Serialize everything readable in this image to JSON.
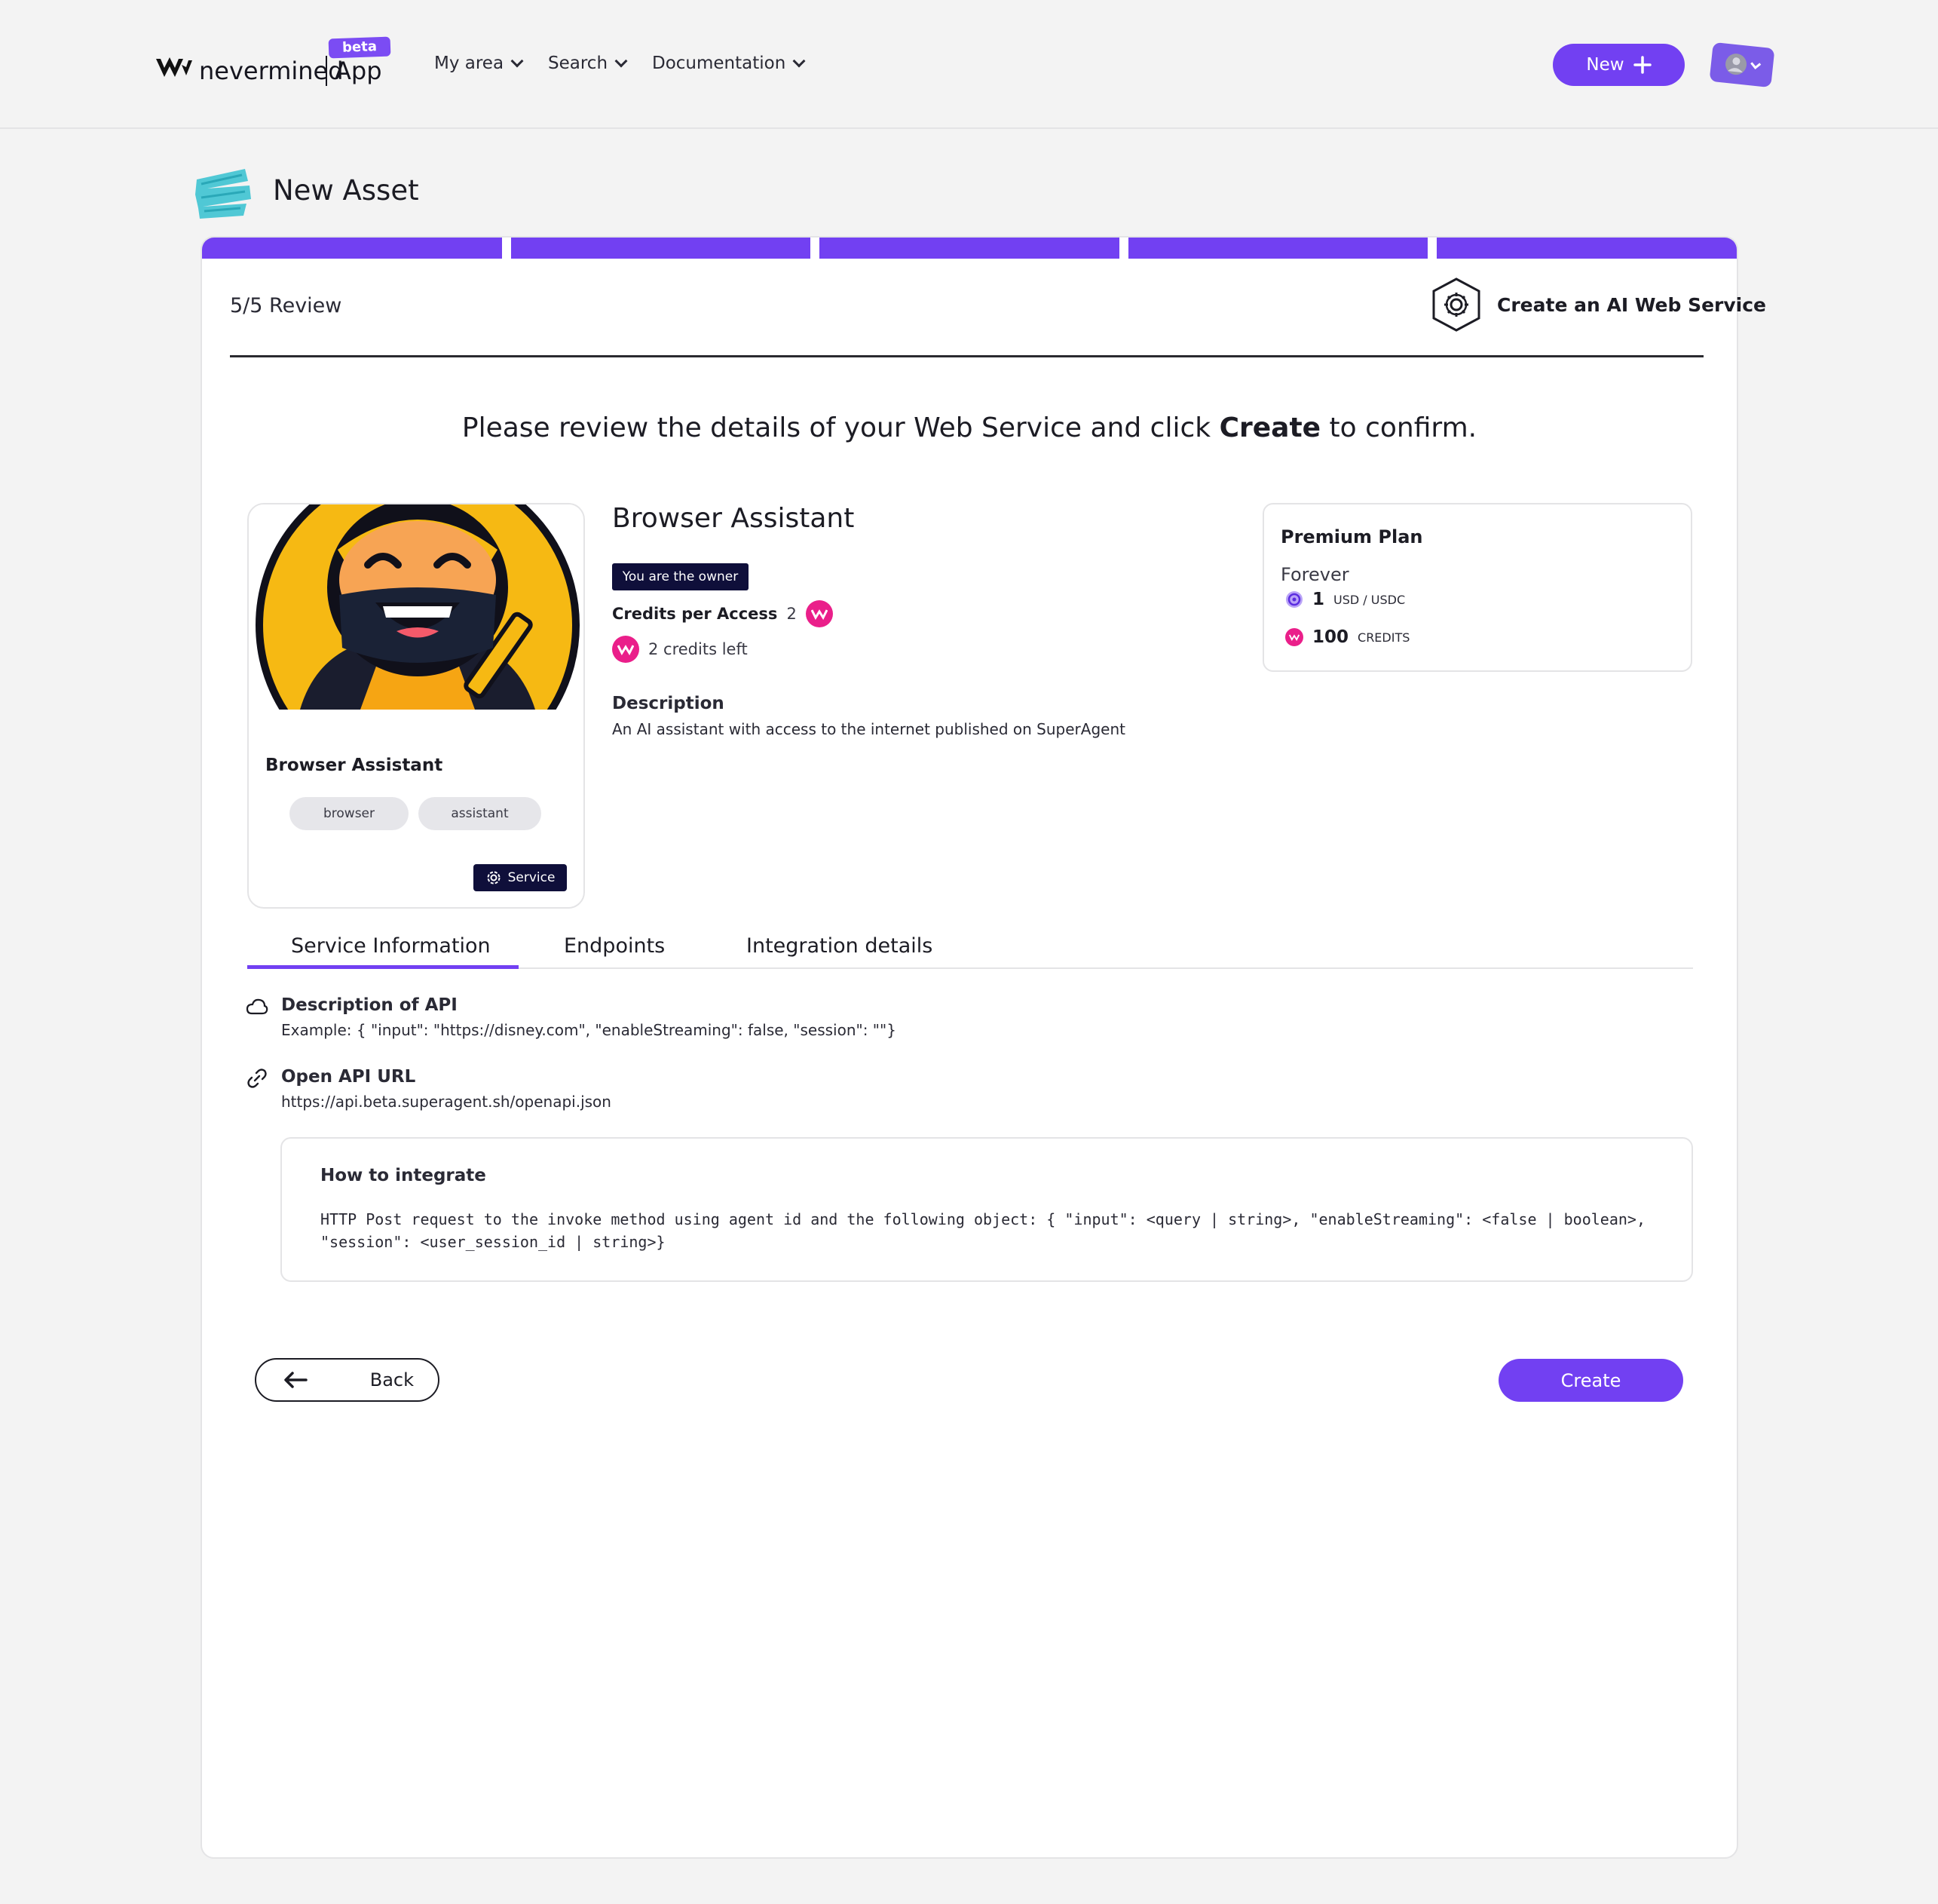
{
  "header": {
    "logo_text": "nevermined",
    "logo_app": "App",
    "beta": "beta",
    "nav": [
      {
        "label": "My area"
      },
      {
        "label": "Search"
      },
      {
        "label": "Documentation"
      }
    ],
    "new_button": "New"
  },
  "page": {
    "title": "New Asset"
  },
  "wizard": {
    "step_label": "5/5 Review",
    "type_label": "Create an AI Web Service",
    "headline_pre": "Please review the details of your Web Service and click ",
    "headline_bold": "Create",
    "headline_post": " to confirm."
  },
  "asset_card": {
    "name": "Browser Assistant",
    "tags": [
      "browser",
      "assistant"
    ],
    "chip": "Service"
  },
  "details": {
    "title": "Browser Assistant",
    "owner_badge": "You are the owner",
    "credits_label": "Credits per Access",
    "credits_value": "2",
    "credits_left": "2 credits left",
    "description_heading": "Description",
    "description_text": "An AI assistant with access to the internet published on SuperAgent"
  },
  "plan": {
    "title": "Premium Plan",
    "duration": "Forever",
    "price": "1",
    "price_unit": "USD / USDC",
    "credits": "100",
    "credits_unit": "CREDITS"
  },
  "tabs": [
    {
      "label": "Service Information",
      "active": true
    },
    {
      "label": "Endpoints",
      "active": false
    },
    {
      "label": "Integration details",
      "active": false
    }
  ],
  "service_info": {
    "api_desc_heading": "Description of API",
    "api_desc_text": "Example: { \"input\": \"https://disney.com\", \"enableStreaming\": false, \"session\": \"\"}",
    "openapi_heading": "Open API URL",
    "openapi_url": "https://api.beta.superagent.sh/openapi.json",
    "integrate_heading": "How to integrate",
    "integrate_code": "HTTP Post request to the invoke method using agent id and the following object: { \"input\": <query | string>, \"enableStreaming\": <false | boolean>, \"session\": <user_session_id | string>}"
  },
  "actions": {
    "back": "Back",
    "create": "Create"
  },
  "colors": {
    "accent": "#7240f2",
    "navy": "#0f0f3a",
    "coin": "#ea1f8a"
  }
}
